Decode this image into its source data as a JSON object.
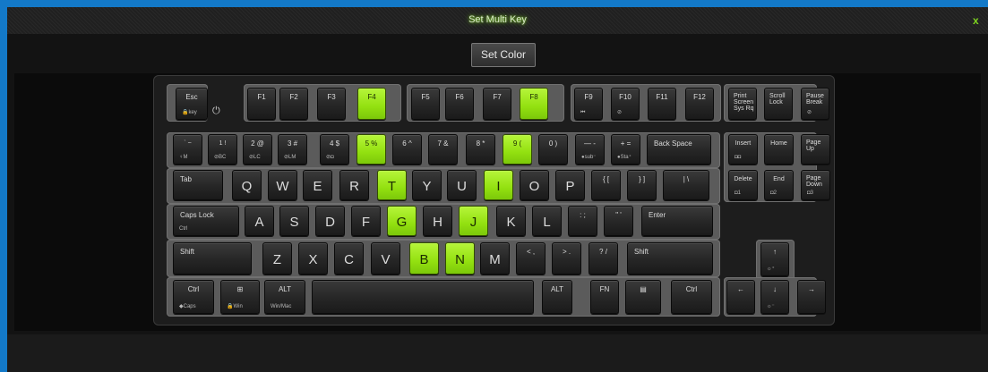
{
  "window": {
    "title": "Set Multi Key",
    "close_label": "x"
  },
  "toolbar": {
    "set_color_label": "Set Color"
  },
  "colors": {
    "highlight": "#93e010",
    "title_glow": "#8ce628",
    "frame": "#1379c8"
  },
  "keyboard": {
    "rows": [
      {
        "id": "function",
        "keys": [
          {
            "label": "Esc",
            "sub": "🔒key"
          },
          {
            "label": "F1"
          },
          {
            "label": "F2"
          },
          {
            "label": "F3"
          },
          {
            "label": "F4",
            "hl": true
          },
          {
            "label": "F5"
          },
          {
            "label": "F6"
          },
          {
            "label": "F7"
          },
          {
            "label": "F8",
            "hl": true
          },
          {
            "label": "F9",
            "sub": "⏮"
          },
          {
            "label": "F10",
            "sub": "⊘"
          },
          {
            "label": "F11"
          },
          {
            "label": "F12"
          },
          {
            "label": "Print\nScreen\nSys Rq"
          },
          {
            "label": "Scroll\nLock"
          },
          {
            "label": "Pause\nBreak",
            "sub": "⊘"
          }
        ]
      },
      {
        "id": "number",
        "keys": [
          {
            "label": "` ~",
            "sub": "♀M"
          },
          {
            "label": "1 !",
            "sub": "⊘BC"
          },
          {
            "label": "2 @",
            "sub": "⊘LC"
          },
          {
            "label": "3 #",
            "sub": "⊘LM"
          },
          {
            "label": "4 $",
            "sub": "⊘◘"
          },
          {
            "label": "5 %",
            "hl": true
          },
          {
            "label": "6 ^"
          },
          {
            "label": "7 &"
          },
          {
            "label": "8 *"
          },
          {
            "label": "9 (",
            "hl": true
          },
          {
            "label": "0 )"
          },
          {
            "label": "— -",
            "sub": "●sub⁻"
          },
          {
            "label": "+ =",
            "sub": "●Sta⁺"
          },
          {
            "label": "Back Space"
          },
          {
            "label": "Insert",
            "sub": "◘◘"
          },
          {
            "label": "Home"
          },
          {
            "label": "Page\nUp"
          }
        ]
      },
      {
        "id": "qwerty",
        "keys": [
          {
            "label": "Tab"
          },
          {
            "label": "Q"
          },
          {
            "label": "W"
          },
          {
            "label": "E"
          },
          {
            "label": "R"
          },
          {
            "label": "T",
            "hl": true
          },
          {
            "label": "Y"
          },
          {
            "label": "U"
          },
          {
            "label": "I",
            "hl": true
          },
          {
            "label": "O"
          },
          {
            "label": "P"
          },
          {
            "label": "{ ["
          },
          {
            "label": "} ]"
          },
          {
            "label": "| \\"
          },
          {
            "label": "Delete",
            "sub": "◘1"
          },
          {
            "label": "End",
            "sub": "◘2"
          },
          {
            "label": "Page\nDown",
            "sub": "◘3"
          }
        ]
      },
      {
        "id": "home",
        "keys": [
          {
            "label": "Caps Lock",
            "sub": "Ctrl"
          },
          {
            "label": "A"
          },
          {
            "label": "S"
          },
          {
            "label": "D"
          },
          {
            "label": "F"
          },
          {
            "label": "G",
            "hl": true
          },
          {
            "label": "H"
          },
          {
            "label": "J",
            "hl": true
          },
          {
            "label": "K"
          },
          {
            "label": "L"
          },
          {
            "label": ": ;"
          },
          {
            "label": "\" '"
          },
          {
            "label": "Enter"
          }
        ]
      },
      {
        "id": "shift",
        "keys": [
          {
            "label": "Shift"
          },
          {
            "label": "Z"
          },
          {
            "label": "X"
          },
          {
            "label": "C"
          },
          {
            "label": "V"
          },
          {
            "label": "B",
            "hl": true
          },
          {
            "label": "N",
            "hl": true
          },
          {
            "label": "M"
          },
          {
            "label": "< ,"
          },
          {
            "label": "> ."
          },
          {
            "label": "? /"
          },
          {
            "label": "Shift"
          },
          {
            "label": "↑",
            "sub": "☼⁺"
          }
        ]
      },
      {
        "id": "bottom",
        "keys": [
          {
            "label": "Ctrl",
            "sub": "◆Caps"
          },
          {
            "label": "⊞",
            "sub": "🔒Win"
          },
          {
            "label": "ALT",
            "sub": "Win/Mac"
          },
          {
            "label": ""
          },
          {
            "label": "ALT"
          },
          {
            "label": "FN"
          },
          {
            "label": "▤"
          },
          {
            "label": "Ctrl"
          },
          {
            "label": "←"
          },
          {
            "label": "↓",
            "sub": "☼⁻"
          },
          {
            "label": "→"
          }
        ]
      }
    ]
  }
}
